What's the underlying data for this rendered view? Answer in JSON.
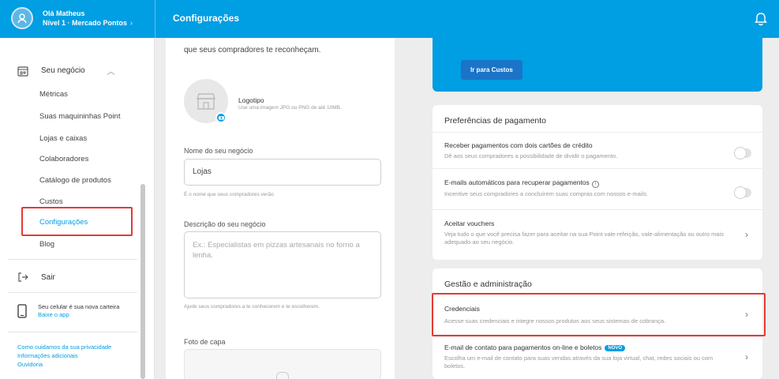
{
  "header": {
    "greeting": "Olá Matheus",
    "level": "Nível 1 · Mercado Pontos",
    "title": "Configurações"
  },
  "sidebar": {
    "section": "Seu negócio",
    "items": [
      {
        "label": "Métricas"
      },
      {
        "label": "Suas maquininhas Point"
      },
      {
        "label": "Lojas e caixas"
      },
      {
        "label": "Colaboradores"
      },
      {
        "label": "Catálogo de produtos"
      },
      {
        "label": "Custos"
      },
      {
        "label": "Configurações"
      },
      {
        "label": "Blog"
      }
    ],
    "exit": "Sair",
    "phone_text": "Seu celular é sua nova carteira",
    "phone_link": "Baixe o app",
    "links": [
      "Como cuidamos da sua privacidade",
      "Informações adicionais",
      "Ouvidoria"
    ]
  },
  "form": {
    "top_text": "que seus compradores te reconheçam.",
    "logo_title": "Logotipo",
    "logo_hint": "Use uma imagem JPG ou PNG de até 10MB.",
    "name_label": "Nome do seu negócio",
    "name_value": "Lojas",
    "name_help": "É o nome que seus compradores verão",
    "desc_label": "Descrição do seu negócio",
    "desc_placeholder": "Ex.: Especialistas em pizzas artesanais no forno a lenha.",
    "desc_help": "Ajude seus compradores a te conhecerem e te escolherem.",
    "cover_label": "Foto de capa"
  },
  "costs": {
    "button": "Ir para Custos"
  },
  "payment_prefs": {
    "title": "Preferências de pagamento",
    "rows": [
      {
        "title": "Receber pagamentos com dois cartões de crédito",
        "desc": "Dê aos seus compradores a possibilidade de dividir o pagamento."
      },
      {
        "title": "E-mails automáticos para recuperar pagamentos",
        "desc": "Incentive seus compradores a concluírem suas compras com nossos e-mails."
      },
      {
        "title": "Aceitar vouchers",
        "desc": "Veja tudo o que você precisa fazer para aceitar na sua Point vale-refeição, vale-alimentação ou outro mais adequado ao seu negócio."
      }
    ]
  },
  "management": {
    "title": "Gestão e administração",
    "rows": [
      {
        "title": "Credenciais",
        "desc": "Acesse suas credenciais e integre nossos produtos aos seus sistemas de cobrança."
      },
      {
        "title": "E-mail de contato para pagamentos on-line e boletos",
        "badge": "NOVO",
        "desc": "Escolha um e-mail de contato para suas vendas através da sua loja virtual, chat, redes sociais ou com boletos."
      }
    ]
  },
  "colors": {
    "brand": "#009ee3",
    "highlight": "#e53935"
  }
}
